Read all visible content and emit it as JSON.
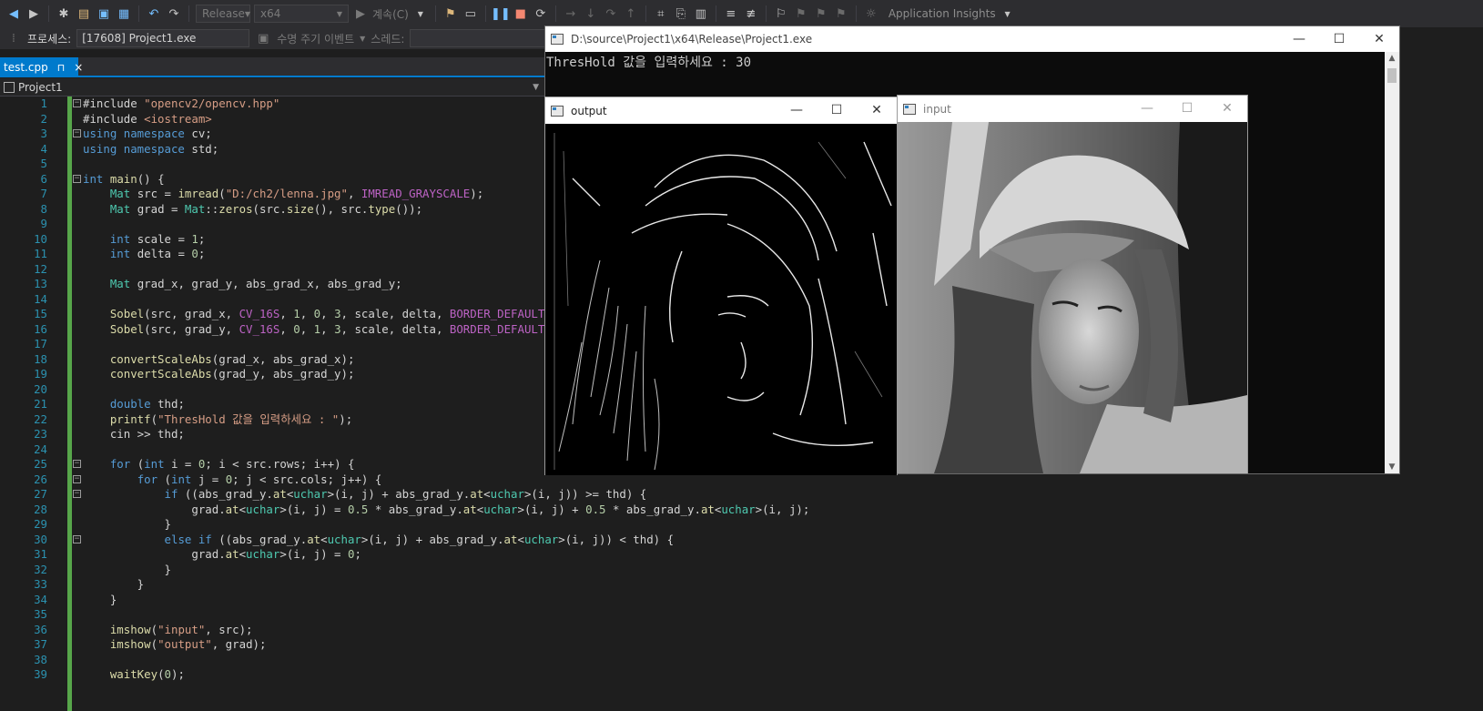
{
  "toolbar": {
    "config": "Release",
    "platform": "x64",
    "continue": "계속(C)",
    "insights": "Application Insights"
  },
  "process": {
    "label": "프로세스:",
    "value": "[17608] Project1.exe",
    "lifecycle": "수명 주기 이벤트",
    "thread": "스레드:"
  },
  "tab": {
    "name": "test.cpp",
    "pin": "⊓",
    "close": "×"
  },
  "nav": {
    "project": "Project1"
  },
  "editor": {
    "lines": [
      {
        "n": "1",
        "fold": "−",
        "html": "#include <span class=\"s\">\"opencv2/opencv.hpp\"</span>"
      },
      {
        "n": "2",
        "fold": "",
        "html": "#include <span class=\"s\">&lt;iostream&gt;</span>"
      },
      {
        "n": "3",
        "fold": "−",
        "html": "<span class=\"k\">using namespace</span> cv;"
      },
      {
        "n": "4",
        "fold": "",
        "html": "<span class=\"k\">using namespace</span> std;"
      },
      {
        "n": "5",
        "fold": "",
        "html": ""
      },
      {
        "n": "6",
        "fold": "−",
        "html": "<span class=\"k\">int</span> <span class=\"f\">main</span>() {"
      },
      {
        "n": "7",
        "fold": "",
        "html": "    <span class=\"t\">Mat</span> src = <span class=\"f\">imread</span>(<span class=\"s\">\"D:/ch2/lenna.jpg\"</span>, <span class=\"m\">IMREAD_GRAYSCALE</span>);"
      },
      {
        "n": "8",
        "fold": "",
        "html": "    <span class=\"t\">Mat</span> grad = <span class=\"t\">Mat</span>::<span class=\"f\">zeros</span>(src.<span class=\"f\">size</span>(), src.<span class=\"f\">type</span>());"
      },
      {
        "n": "9",
        "fold": "",
        "html": ""
      },
      {
        "n": "10",
        "fold": "",
        "html": "    <span class=\"k\">int</span> scale = <span class=\"n\">1</span>;"
      },
      {
        "n": "11",
        "fold": "",
        "html": "    <span class=\"k\">int</span> delta = <span class=\"n\">0</span>;"
      },
      {
        "n": "12",
        "fold": "",
        "html": ""
      },
      {
        "n": "13",
        "fold": "",
        "html": "    <span class=\"t\">Mat</span> grad_x, grad_y, abs_grad_x, abs_grad_y;"
      },
      {
        "n": "14",
        "fold": "",
        "html": ""
      },
      {
        "n": "15",
        "fold": "",
        "html": "    <span class=\"f\">Sobel</span>(src, grad_x, <span class=\"m\">CV_16S</span>, <span class=\"n\">1</span>, <span class=\"n\">0</span>, <span class=\"n\">3</span>, scale, delta, <span class=\"m\">BORDER_DEFAULT</span>);"
      },
      {
        "n": "16",
        "fold": "",
        "html": "    <span class=\"f\">Sobel</span>(src, grad_y, <span class=\"m\">CV_16S</span>, <span class=\"n\">0</span>, <span class=\"n\">1</span>, <span class=\"n\">3</span>, scale, delta, <span class=\"m\">BORDER_DEFAULT</span>);"
      },
      {
        "n": "17",
        "fold": "",
        "html": ""
      },
      {
        "n": "18",
        "fold": "",
        "html": "    <span class=\"f\">convertScaleAbs</span>(grad_x, abs_grad_x);"
      },
      {
        "n": "19",
        "fold": "",
        "html": "    <span class=\"f\">convertScaleAbs</span>(grad_y, abs_grad_y);"
      },
      {
        "n": "20",
        "fold": "",
        "html": ""
      },
      {
        "n": "21",
        "fold": "",
        "html": "    <span class=\"k\">double</span> thd;"
      },
      {
        "n": "22",
        "fold": "",
        "html": "    <span class=\"f\">printf</span>(<span class=\"s\">\"ThresHold 값을 입력하세요 : \"</span>);"
      },
      {
        "n": "23",
        "fold": "",
        "html": "    cin &gt;&gt; thd;"
      },
      {
        "n": "24",
        "fold": "",
        "html": ""
      },
      {
        "n": "25",
        "fold": "−",
        "html": "    <span class=\"k\">for</span> (<span class=\"k\">int</span> i = <span class=\"n\">0</span>; i &lt; src.rows; i++) {"
      },
      {
        "n": "26",
        "fold": "−",
        "html": "        <span class=\"k\">for</span> (<span class=\"k\">int</span> j = <span class=\"n\">0</span>; j &lt; src.cols; j++) {"
      },
      {
        "n": "27",
        "fold": "−",
        "html": "            <span class=\"k\">if</span> ((abs_grad_y.<span class=\"f\">at</span>&lt;<span class=\"t\">uchar</span>&gt;(i, j) + abs_grad_y.<span class=\"f\">at</span>&lt;<span class=\"t\">uchar</span>&gt;(i, j)) &gt;= thd) {"
      },
      {
        "n": "28",
        "fold": "",
        "html": "                grad.<span class=\"f\">at</span>&lt;<span class=\"t\">uchar</span>&gt;(i, j) = <span class=\"n\">0.5</span> * abs_grad_y.<span class=\"f\">at</span>&lt;<span class=\"t\">uchar</span>&gt;(i, j) + <span class=\"n\">0.5</span> * abs_grad_y.<span class=\"f\">at</span>&lt;<span class=\"t\">uchar</span>&gt;(i, j);"
      },
      {
        "n": "29",
        "fold": "",
        "html": "            }"
      },
      {
        "n": "30",
        "fold": "−",
        "html": "            <span class=\"k\">else if</span> ((abs_grad_y.<span class=\"f\">at</span>&lt;<span class=\"t\">uchar</span>&gt;(i, j) + abs_grad_y.<span class=\"f\">at</span>&lt;<span class=\"t\">uchar</span>&gt;(i, j)) &lt; thd) {"
      },
      {
        "n": "31",
        "fold": "",
        "html": "                grad.<span class=\"f\">at</span>&lt;<span class=\"t\">uchar</span>&gt;(i, j) = <span class=\"n\">0</span>;"
      },
      {
        "n": "32",
        "fold": "",
        "html": "            }"
      },
      {
        "n": "33",
        "fold": "",
        "html": "        }"
      },
      {
        "n": "34",
        "fold": "",
        "html": "    }"
      },
      {
        "n": "35",
        "fold": "",
        "html": ""
      },
      {
        "n": "36",
        "fold": "",
        "html": "    <span class=\"f\">imshow</span>(<span class=\"s\">\"input\"</span>, src);"
      },
      {
        "n": "37",
        "fold": "",
        "html": "    <span class=\"f\">imshow</span>(<span class=\"s\">\"output\"</span>, grad);"
      },
      {
        "n": "38",
        "fold": "",
        "html": ""
      },
      {
        "n": "39",
        "fold": "",
        "html": "    <span class=\"f\">waitKey</span>(<span class=\"n\">0</span>);"
      }
    ]
  },
  "console": {
    "title": "D:\\source\\Project1\\x64\\Release\\Project1.exe",
    "output": "ThresHold 값을 입력하세요 : 30"
  },
  "windows": {
    "output_title": "output",
    "input_title": "input"
  },
  "colors": {
    "accent": "#007acc",
    "change_bar": "#57a64a",
    "editor_bg": "#1e1e1e"
  }
}
